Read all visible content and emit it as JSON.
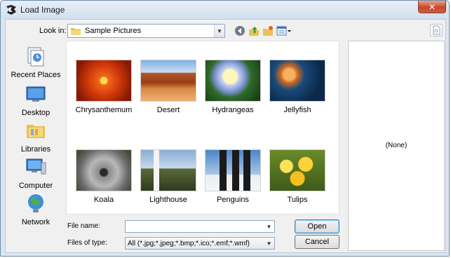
{
  "window": {
    "title": "Load Image",
    "app_icon": "paint-application-icon",
    "close_icon": "close-icon",
    "close_glyph": "✕"
  },
  "look_in": {
    "label": "Look in:",
    "value": "Sample Pictures",
    "folder_icon": "folder-icon"
  },
  "toolbar": {
    "icons": [
      "back-icon",
      "up-one-level-icon",
      "new-folder-icon",
      "view-menu-icon"
    ]
  },
  "places": [
    {
      "label": "Recent Places",
      "icon": "recent-places-icon"
    },
    {
      "label": "Desktop",
      "icon": "desktop-icon"
    },
    {
      "label": "Libraries",
      "icon": "libraries-icon"
    },
    {
      "label": "Computer",
      "icon": "computer-icon"
    },
    {
      "label": "Network",
      "icon": "network-icon"
    }
  ],
  "files": [
    {
      "name": "Chrysanthemum"
    },
    {
      "name": "Desert"
    },
    {
      "name": "Hydrangeas"
    },
    {
      "name": "Jellyfish"
    },
    {
      "name": "Koala"
    },
    {
      "name": "Lighthouse"
    },
    {
      "name": "Penguins"
    },
    {
      "name": "Tulips"
    }
  ],
  "preview": {
    "text": "(None)",
    "toggle_icon": "preview-toggle-icon"
  },
  "file_name": {
    "label": "File name:",
    "value": "",
    "placeholder": ""
  },
  "file_type": {
    "label": "Files of type:",
    "value": "All (*.jpg;*.jpeg;*.bmp;*.ico;*.emf;*.wmf)"
  },
  "buttons": {
    "open": "Open",
    "cancel": "Cancel"
  },
  "dropdown_glyph": "▼",
  "colors": {
    "title_bar": "#dbe6f3",
    "close_button": "#c7482c",
    "default_button_border": "#3c7fb1"
  }
}
